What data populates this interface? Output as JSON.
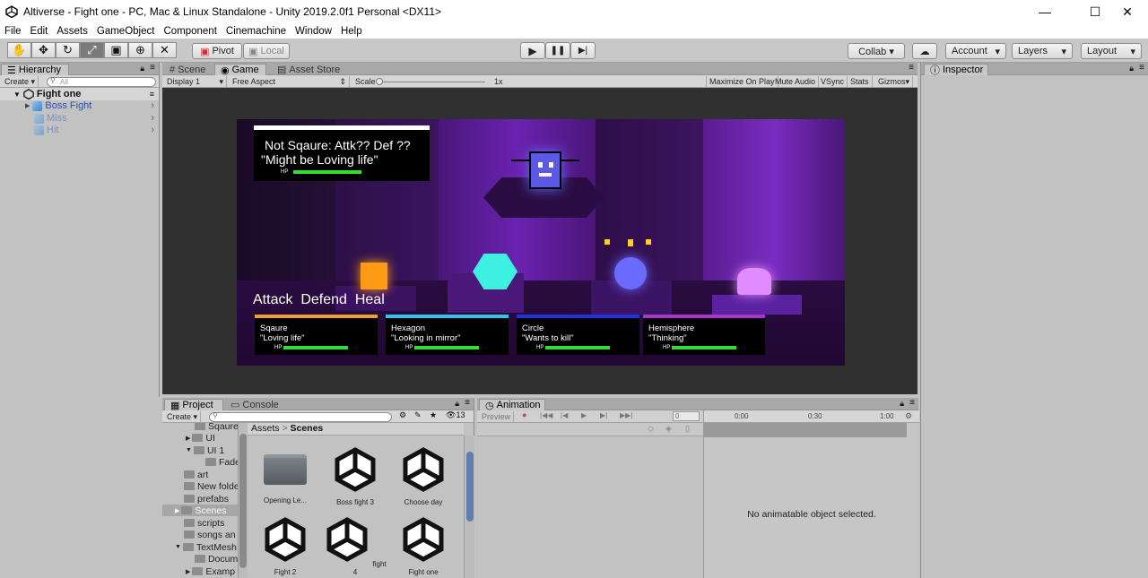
{
  "window": {
    "title": "Altiverse - Fight one - PC, Mac & Linux Standalone - Unity 2019.2.0f1 Personal <DX11>",
    "minimize": "—",
    "maximize": "☐",
    "close": "✕"
  },
  "menu": [
    "File",
    "Edit",
    "Assets",
    "GameObject",
    "Component",
    "Cinemachine",
    "Window",
    "Help"
  ],
  "toolbar": {
    "tools": [
      "hand-tool",
      "move-tool",
      "rotate-tool",
      "scale-tool",
      "rect-tool",
      "transform-tool",
      "custom-tool"
    ],
    "tool_glyphs": [
      "✋",
      "✥",
      "↻",
      "⤢",
      "▣",
      "⊕",
      "✕"
    ],
    "pivot": "Pivot",
    "local": "Local",
    "play": "▶",
    "pause": "❚❚",
    "step": "▶|",
    "collab": "Collab ▾",
    "cloud": "☁",
    "account": "Account",
    "layers": "Layers",
    "layout": "Layout"
  },
  "hierarchy": {
    "tab": "Hierarchy",
    "create": "Create",
    "search_placeholder": "All",
    "scene": "Fight one",
    "items": [
      "Boss Fight",
      "Miss",
      "Hit"
    ]
  },
  "gameview": {
    "tabs": [
      "Scene",
      "Game",
      "Asset Store"
    ],
    "display": "Display 1",
    "aspect": "Free Aspect",
    "scale_label": "Scale",
    "scale_value": "1x",
    "options": [
      "Maximize On Play",
      "Mute Audio",
      "VSync",
      "Stats",
      "Gizmos"
    ]
  },
  "game": {
    "boss_line1": "Not Sqaure: Attk?? Def ??",
    "boss_line2": "\"Might be Loving life\"",
    "hp": "HP",
    "actions": "Attack  Defend  Heal",
    "party": [
      {
        "name": "Sqaure",
        "quote": "\"Loving life\"",
        "color": "#f0a030",
        "hp": 1.0
      },
      {
        "name": "Hexagon",
        "quote": "\"Looking in mirror\"",
        "color": "#33c4ee",
        "hp": 1.0
      },
      {
        "name": "Circle",
        "quote": "\"Wants to kill\"",
        "color": "#2233dd",
        "hp": 1.0
      },
      {
        "name": "Hemisphere",
        "quote": "\"Thinking\"",
        "color": "#aa33cc",
        "hp": 1.0
      }
    ]
  },
  "inspector": {
    "tab": "Inspector"
  },
  "project": {
    "tabs": [
      "Project",
      "Console"
    ],
    "create": "Create",
    "count": "13",
    "tree": [
      "Sqaure",
      "UI",
      "UI 1",
      "Fade",
      "art",
      "New folde",
      "prefabs",
      "Scenes",
      "scripts",
      "songs an",
      "TextMesh",
      "Docum",
      "Examp"
    ],
    "breadcrumb_root": "Assets",
    "breadcrumb_sep": ">",
    "breadcrumb_current": "Scenes",
    "assets": [
      "Opening Le...",
      "Boss fight 3",
      "Choose day",
      "Fight 2",
      "fight 4",
      "Fight one"
    ]
  },
  "animation": {
    "tab": "Animation",
    "preview": "Preview",
    "frame": "0",
    "times": [
      "0:00",
      "0:30",
      "1:00"
    ],
    "empty_message": "No animatable object selected."
  }
}
